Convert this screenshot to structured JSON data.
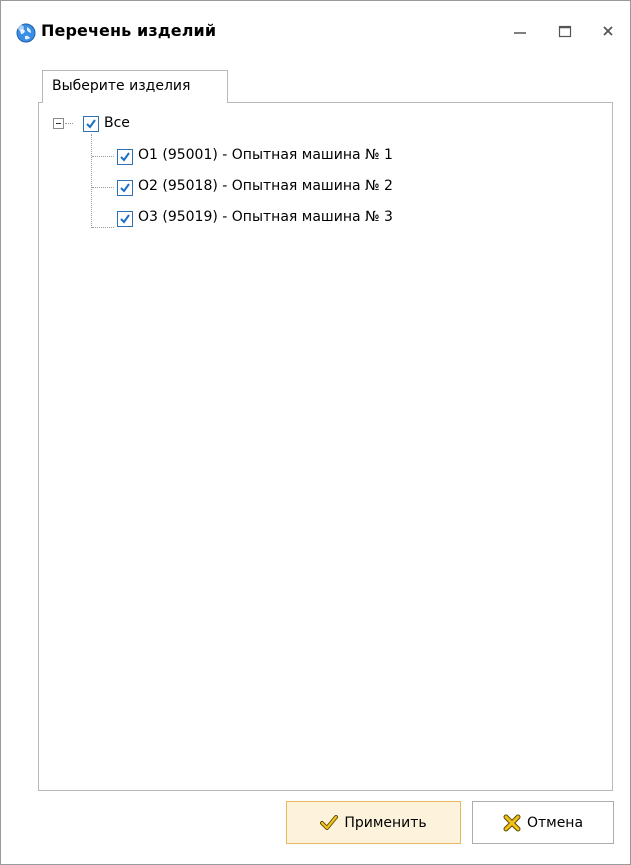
{
  "window": {
    "title": "Перечень изделий",
    "icon": "globe-icon",
    "controls": [
      "minimize-icon",
      "maximize-icon",
      "close-icon"
    ]
  },
  "tab": {
    "label": "Выберите изделия"
  },
  "tree": {
    "root": {
      "label": "Все",
      "checked": true,
      "expanded": true
    },
    "items": [
      {
        "label": "О1 (95001) - Опытная машина № 1",
        "checked": true
      },
      {
        "label": "О2 (95018) - Опытная машина № 2",
        "checked": true
      },
      {
        "label": "О3 (95019) - Опытная машина № 3",
        "checked": true
      }
    ]
  },
  "buttons": {
    "apply_label": "Применить",
    "cancel_label": "Отмена"
  },
  "colors": {
    "check": "#1a6fc7",
    "apply_bg": "#fdf3dc",
    "apply_border": "#e6b95c"
  }
}
